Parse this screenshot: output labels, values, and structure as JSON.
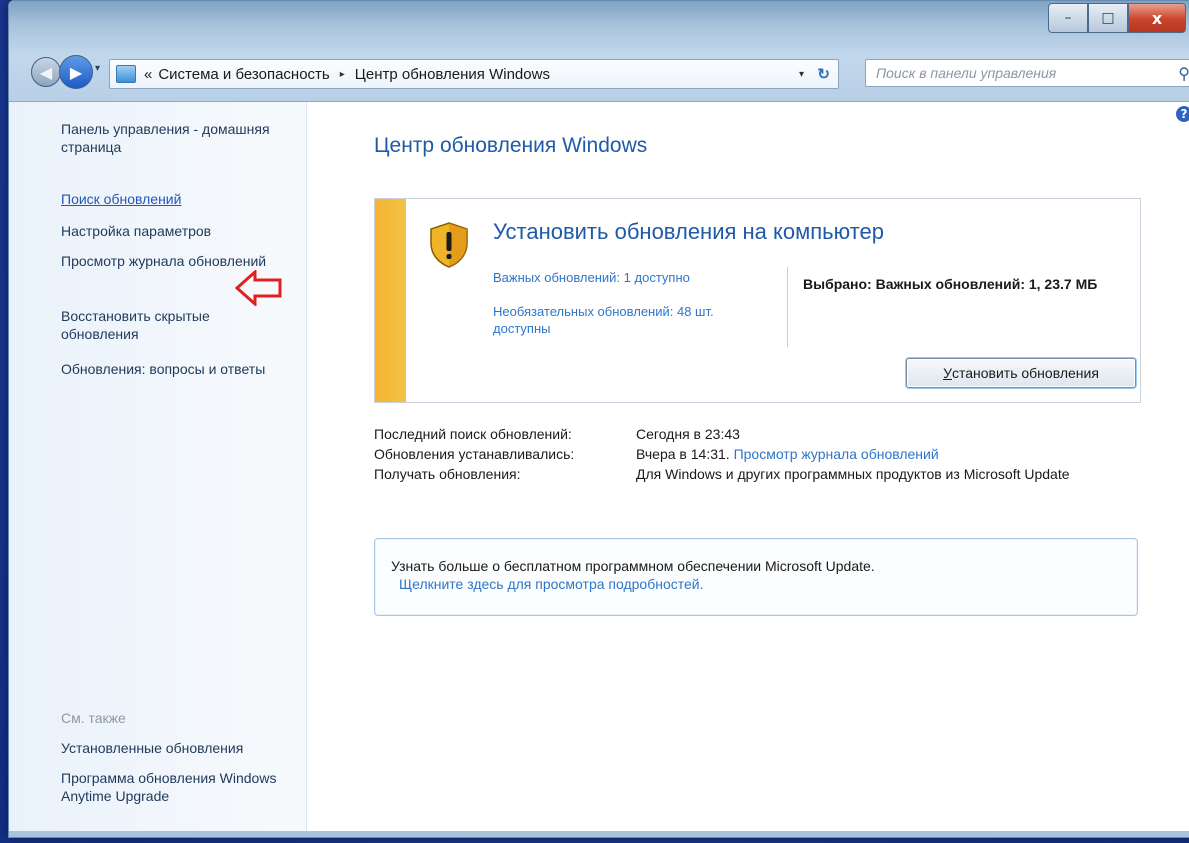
{
  "window": {
    "controls": {
      "minimize": "–",
      "maximize": "□",
      "close": "x"
    }
  },
  "nav": {
    "back_icon": "arrow-left-icon",
    "forward_icon": "arrow-right-icon",
    "breadcrumb_prefix": "«",
    "breadcrumb": [
      "Система и безопасность",
      "Центр обновления Windows"
    ],
    "breadcrumb_separator": "▸",
    "search_placeholder": "Поиск в панели управления"
  },
  "sidebar": {
    "home": "Панель управления - домашняя страница",
    "items": [
      "Поиск обновлений",
      "Настройка параметров",
      "Просмотр журнала обновлений",
      "Восстановить скрытые обновления",
      "Обновления: вопросы и ответы"
    ],
    "see_also_label": "См. также",
    "see_also": [
      "Установленные обновления",
      "Программа обновления Windows Anytime Upgrade"
    ]
  },
  "main": {
    "title": "Центр обновления Windows",
    "panel": {
      "heading": "Установить обновления на компьютер",
      "important_link": "Важных обновлений: 1 доступно",
      "optional_link": "Необязательных обновлений: 48 шт. доступны",
      "selected": "Выбрано: Важных обновлений: 1, 23.7 МБ",
      "install_button_accel": "У",
      "install_button_rest": "становить обновления"
    },
    "info": {
      "last_check_label": "Последний поиск обновлений:",
      "last_check_value": "Сегодня в 23:43",
      "installed_label": "Обновления устанавливались:",
      "installed_value": "Вчера в 14:31.",
      "installed_link": "Просмотр журнала обновлений",
      "receive_label": "Получать обновления:",
      "receive_value": "Для Windows и других программных продуктов из Microsoft Update"
    },
    "more": {
      "text": "Узнать больше о бесплатном программном обеспечении Microsoft Update.",
      "link": "Щелкните здесь для просмотра подробностей."
    }
  },
  "colors": {
    "accent_link": "#2f76c8",
    "title_blue": "#1e5aa8",
    "warning_bar": "#f6b431",
    "annotation_arrow": "#e02020"
  }
}
